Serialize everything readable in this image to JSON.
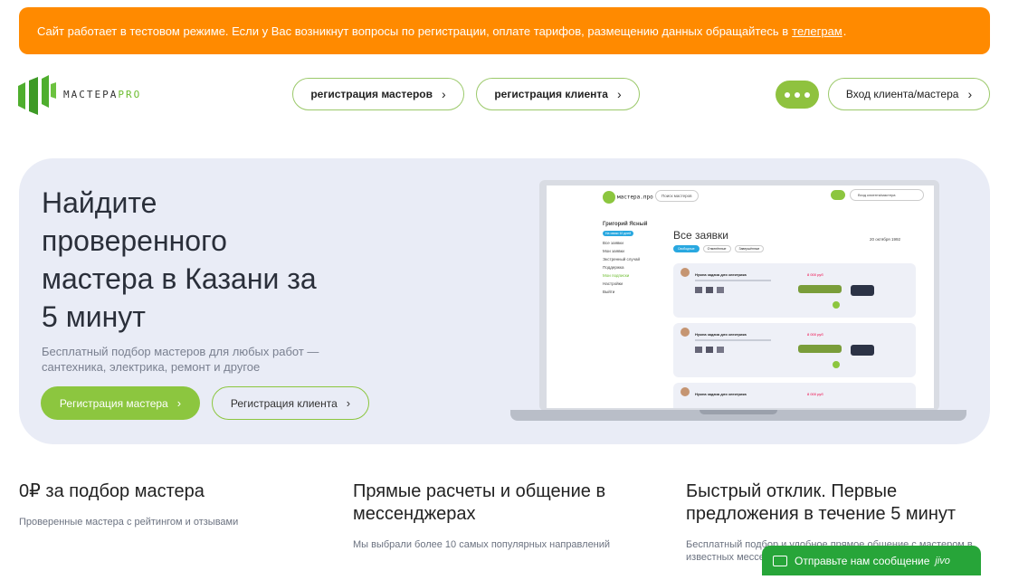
{
  "banner": {
    "text": "Сайт работает в тестовом режиме. Если у Вас возникнут вопросы по регистрации, оплате тарифов, размещению данных обращайтесь в",
    "link": "телеграм",
    "period": ".",
    "color": "#ff8a00"
  },
  "header": {
    "logo_main": "МАСТЕРА",
    "logo_accent": "PRO",
    "register_masters": "регистрация мастеров",
    "register_client": "регистрация клиента",
    "login": "Вход клиента/мастера",
    "menu_icon": "dots-icon"
  },
  "hero": {
    "title": "Найдите проверенного мастера в Казани за 5 минут",
    "subtitle": "Бесплатный подбор мастеров для любых работ — сантехника, электрика, ремонт и другое",
    "btn_master": "Регистрация мастера",
    "btn_client": "Регистрация клиента",
    "accent": "#8cc63f"
  },
  "laptop": {
    "logo": "мастера.про",
    "search": "Поиск мастеров",
    "login": "Вход клиента/мастера",
    "user_name": "Григорий Ясный",
    "user_tag": "На связи 10 дней",
    "menu": [
      "Все заявки",
      "Мои заявки",
      "Экстренный случай",
      "Поддержка",
      "Мои подписки",
      "Настройки",
      "Выйти"
    ],
    "page_title": "Все заявки",
    "tabs": [
      "Свободные",
      "Отменённые",
      "Завершённые"
    ],
    "date": "20 октября 1992",
    "card_title": "Нужна задача для электрика",
    "price": "8 000 руб"
  },
  "features": [
    {
      "title": "0₽ за подбор мастера",
      "text": "Проверенные мастера с рейтингом и отзывами"
    },
    {
      "title": "Прямые расчеты и общение в мессенджерах",
      "text": "Мы выбрали более 10 самых популярных направлений"
    },
    {
      "title": "Быстрый отклик. Первые предложения в течение 5 минут",
      "text": "Бесплатный подбор и удобное прямое общение с мастером в известных мессе"
    }
  ],
  "chat": {
    "label": "Отправьте нам сообщение",
    "brand": "jivo",
    "color": "#27a539"
  }
}
